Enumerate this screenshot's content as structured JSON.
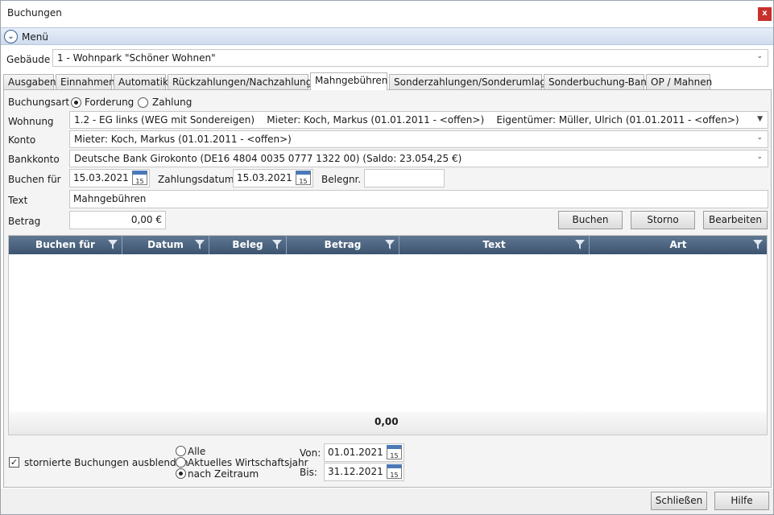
{
  "window": {
    "title": "Buchungen",
    "close_label": "x"
  },
  "menu": {
    "label": "Menü"
  },
  "gebaeude": {
    "label": "Gebäude",
    "value": "1 - Wohnpark \"Schöner Wohnen\""
  },
  "tabs": [
    {
      "label": "Ausgaben",
      "active": false
    },
    {
      "label": "Einnahmen",
      "active": false
    },
    {
      "label": "Automatik",
      "active": false
    },
    {
      "label": "Rückzahlungen/Nachzahlungen",
      "active": false
    },
    {
      "label": "Mahngebühren",
      "active": true
    },
    {
      "label": "Sonderzahlungen/Sonderumlagen",
      "active": false
    },
    {
      "label": "Sonderbuchung-Bank",
      "active": false
    },
    {
      "label": "OP / Mahnen",
      "active": false
    }
  ],
  "form": {
    "buchungsart_label": "Buchungsart",
    "buchungsart_options": [
      "Forderung",
      "Zahlung"
    ],
    "buchungsart_selected": "Forderung",
    "wohnung_label": "Wohnung",
    "wohnung_value": "1.2 - EG links (WEG mit Sondereigen)    Mieter: Koch, Markus (01.01.2011 - <offen>)    Eigentümer: Müller, Ulrich (01.01.2011 - <offen>)",
    "konto_label": "Konto",
    "konto_value": "Mieter: Koch, Markus (01.01.2011 - <offen>)",
    "bankkonto_label": "Bankkonto",
    "bankkonto_value": "Deutsche Bank Girokonto (DE16 4804 0035 0777 1322 00) (Saldo: 23.054,25 €)",
    "buchen_fuer_label": "Buchen für",
    "buchen_fuer_value": "15.03.2021",
    "zahlungsdatum_label": "Zahlungsdatum",
    "zahlungsdatum_value": "15.03.2021",
    "belegnr_label": "Belegnr.",
    "belegnr_value": "",
    "text_label": "Text",
    "text_value": "Mahngebühren",
    "betrag_label": "Betrag",
    "betrag_value": "0,00 €",
    "calendar_day": "15"
  },
  "actions": {
    "buchen": "Buchen",
    "storno": "Storno",
    "bearbeiten": "Bearbeiten"
  },
  "grid": {
    "columns": [
      "Buchen für",
      "Datum",
      "Beleg",
      "Betrag",
      "Text",
      "Art"
    ],
    "rows": [],
    "total": "0,00"
  },
  "filter": {
    "hide_cancelled_label": "stornierte Buchungen ausblenden",
    "hide_cancelled_checked": true,
    "range_options": [
      "Alle",
      "Aktuelles Wirtschaftsjahr",
      "nach Zeitraum"
    ],
    "range_selected": "nach Zeitraum",
    "von_label": "Von:",
    "von_value": "01.01.2021",
    "bis_label": "Bis:",
    "bis_value": "31.12.2021"
  },
  "footer": {
    "close_label": "Schließen",
    "help_label": "Hilfe"
  },
  "colors": {
    "grid_header": "#4a6380",
    "close_button": "#c9302c",
    "menu_bar": "#d9e4f2"
  },
  "icons": [
    "chevron-down-icon",
    "close-icon",
    "calendar-icon",
    "filter-icon",
    "checkmark-icon",
    "dropdown-arrow-icon"
  ]
}
